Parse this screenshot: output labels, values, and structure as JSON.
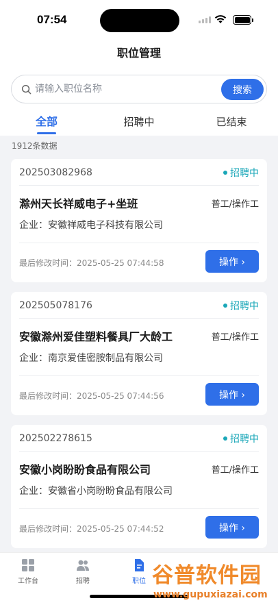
{
  "status_bar": {
    "time": "07:54"
  },
  "header": {
    "title": "职位管理"
  },
  "search": {
    "placeholder": "请输入职位名称",
    "button_label": "搜索"
  },
  "tabs": [
    {
      "label": "全部",
      "active": true
    },
    {
      "label": "招聘中",
      "active": false
    },
    {
      "label": "已结束",
      "active": false
    }
  ],
  "count_text": "1912条数据",
  "jobs": [
    {
      "code": "202503082968",
      "status": "招聘中",
      "title": "滁州天长祥威电子+坐班",
      "type": "普工/操作工",
      "company": "企业：安徽祥威电子科技有限公司",
      "modified": "最后修改时间：2025-05-25 07:44:58",
      "action_label": "操作 ›"
    },
    {
      "code": "202505078176",
      "status": "招聘中",
      "title": "安徽滁州爱佳塑料餐具厂大龄工",
      "type": "普工/操作工",
      "company": "企业：南京爱佳密胺制品有限公司",
      "modified": "最后修改时间：2025-05-25 07:44:56",
      "action_label": "操作 ›"
    },
    {
      "code": "202502278615",
      "status": "招聘中",
      "title": "安徽小岗盼盼食品有限公司",
      "type": "普工/操作工",
      "company": "企业：安徽省小岗盼盼食品有限公司",
      "modified": "最后修改时间：2025-05-25 07:44:52",
      "action_label": "操作 ›"
    }
  ],
  "tabbar": [
    {
      "label": "工作台",
      "icon": "grid-icon",
      "active": false
    },
    {
      "label": "招聘",
      "icon": "people-icon",
      "active": false
    },
    {
      "label": "职位",
      "icon": "document-icon",
      "active": true
    }
  ],
  "watermark": {
    "text": "谷普软件园",
    "url": "www.gupuxiazai.com"
  },
  "colors": {
    "accent": "#2f6fe8",
    "status_teal": "#1aa7b8",
    "watermark": "#f08a2b"
  }
}
